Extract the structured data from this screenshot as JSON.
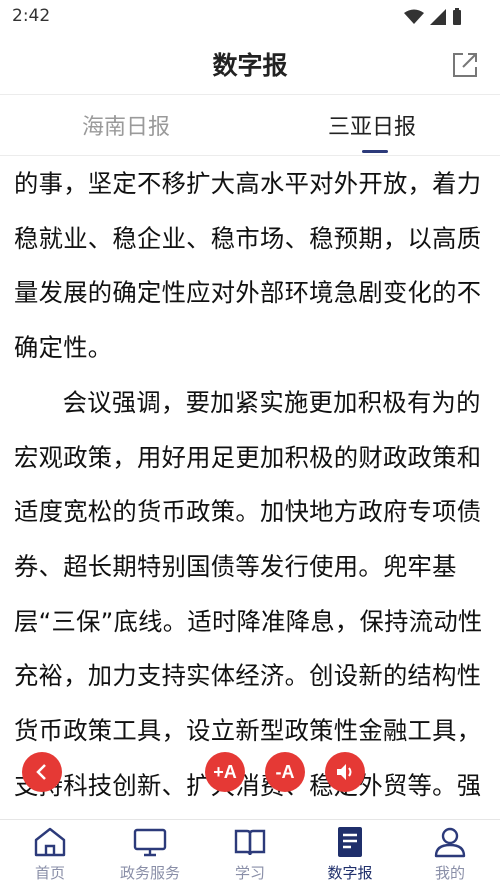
{
  "status_bar": {
    "time": "2:42"
  },
  "header": {
    "title": "数字报",
    "share_icon": "share-external-icon"
  },
  "tabs": [
    {
      "label": "海南日报",
      "active": false
    },
    {
      "label": "三亚日报",
      "active": true
    }
  ],
  "article": {
    "paragraphs": [
      "的事，坚定不移扩大高水平对外开放，着力稳就业、稳企业、稳市场、稳预期，以高质量发展的确定性应对外部环境急剧变化的不确定性。",
      "会议强调，要加紧实施更加积极有为的宏观政策，用好用足更加积极的财政政策和适度宽松的货币政策。加快地方政府专项债券、超长期特别国债等发行使用。兜牢基层“三保”底线。适时降准降息，保持流动性充裕，加力支持实体经济。创设新的结构性货币政策工具，设立新型政策性金融工具，支持科技创新、扩大消费、稳定外贸等。强化"
    ]
  },
  "float_buttons": {
    "back_icon": "chevron-left-icon",
    "font_up": "+A",
    "font_down": "-A",
    "audio_icon": "speaker-icon"
  },
  "bottom_nav": [
    {
      "label": "首页",
      "icon": "home-icon",
      "active": false
    },
    {
      "label": "政务服务",
      "icon": "monitor-icon",
      "active": false
    },
    {
      "label": "学习",
      "icon": "book-icon",
      "active": false
    },
    {
      "label": "数字报",
      "icon": "newspaper-icon",
      "active": true
    },
    {
      "label": "我的",
      "icon": "user-icon",
      "active": false
    }
  ],
  "colors": {
    "accent": "#e53935",
    "nav_active": "#1f2f6b",
    "nav_inactive": "#8a8fa8"
  }
}
